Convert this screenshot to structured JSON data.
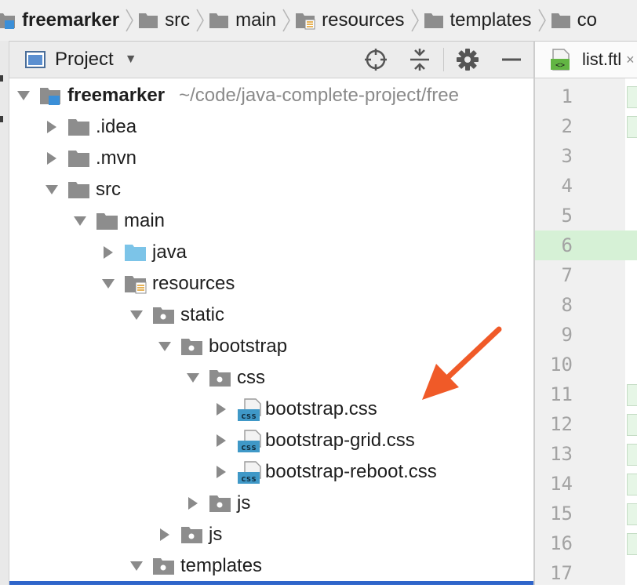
{
  "breadcrumb": {
    "items": [
      {
        "label": "freemarker",
        "icon": "module-folder-icon",
        "bold": true
      },
      {
        "label": "src",
        "icon": "folder-icon",
        "bold": false
      },
      {
        "label": "main",
        "icon": "folder-icon",
        "bold": false
      },
      {
        "label": "resources",
        "icon": "resources-folder-icon",
        "bold": false
      },
      {
        "label": "templates",
        "icon": "folder-icon",
        "bold": false
      },
      {
        "label": "co",
        "icon": "folder-icon",
        "bold": false
      }
    ]
  },
  "project_panel": {
    "title": "Project",
    "tools": [
      "locate-icon",
      "collapse-all-icon",
      "gear-icon",
      "minimize-icon"
    ]
  },
  "tree": [
    {
      "name": "freemarker",
      "path": "~/code/java-complete-project/free",
      "level": 0,
      "expanded": true,
      "icon": "module-folder",
      "bold": true
    },
    {
      "name": ".idea",
      "level": 1,
      "expanded": false,
      "icon": "folder"
    },
    {
      "name": ".mvn",
      "level": 1,
      "expanded": false,
      "icon": "folder"
    },
    {
      "name": "src",
      "level": 1,
      "expanded": true,
      "icon": "folder"
    },
    {
      "name": "main",
      "level": 2,
      "expanded": true,
      "icon": "folder"
    },
    {
      "name": "java",
      "level": 3,
      "expanded": false,
      "icon": "source-folder"
    },
    {
      "name": "resources",
      "level": 3,
      "expanded": true,
      "icon": "resources-folder"
    },
    {
      "name": "static",
      "level": 4,
      "expanded": true,
      "icon": "package-folder"
    },
    {
      "name": "bootstrap",
      "level": 5,
      "expanded": true,
      "icon": "package-folder"
    },
    {
      "name": "css",
      "level": 6,
      "expanded": true,
      "icon": "package-folder"
    },
    {
      "name": "bootstrap.css",
      "level": 7,
      "expanded": false,
      "icon": "css-file"
    },
    {
      "name": "bootstrap-grid.css",
      "level": 7,
      "expanded": false,
      "icon": "css-file"
    },
    {
      "name": "bootstrap-reboot.css",
      "level": 7,
      "expanded": false,
      "icon": "css-file"
    },
    {
      "name": "js",
      "level": 6,
      "expanded": false,
      "icon": "package-folder"
    },
    {
      "name": "js",
      "level": 5,
      "expanded": false,
      "icon": "package-folder"
    },
    {
      "name": "templates",
      "level": 4,
      "expanded": true,
      "icon": "package-folder"
    }
  ],
  "css_badge": "css",
  "editor": {
    "tab_label": "list.ftl",
    "tab_close": "×",
    "tab_icon": "ftl-file-icon",
    "line_numbers": [
      "1",
      "2",
      "3",
      "4",
      "5",
      "6",
      "7",
      "8",
      "9",
      "10",
      "11",
      "12",
      "13",
      "14",
      "15",
      "16",
      "17"
    ],
    "highlighted_line": 6,
    "highlight_color": "#d6f1d6"
  },
  "colors": {
    "selection": "#2f65ca",
    "annotation_arrow": "#f05a28",
    "source_folder": "#7cc4e8"
  }
}
